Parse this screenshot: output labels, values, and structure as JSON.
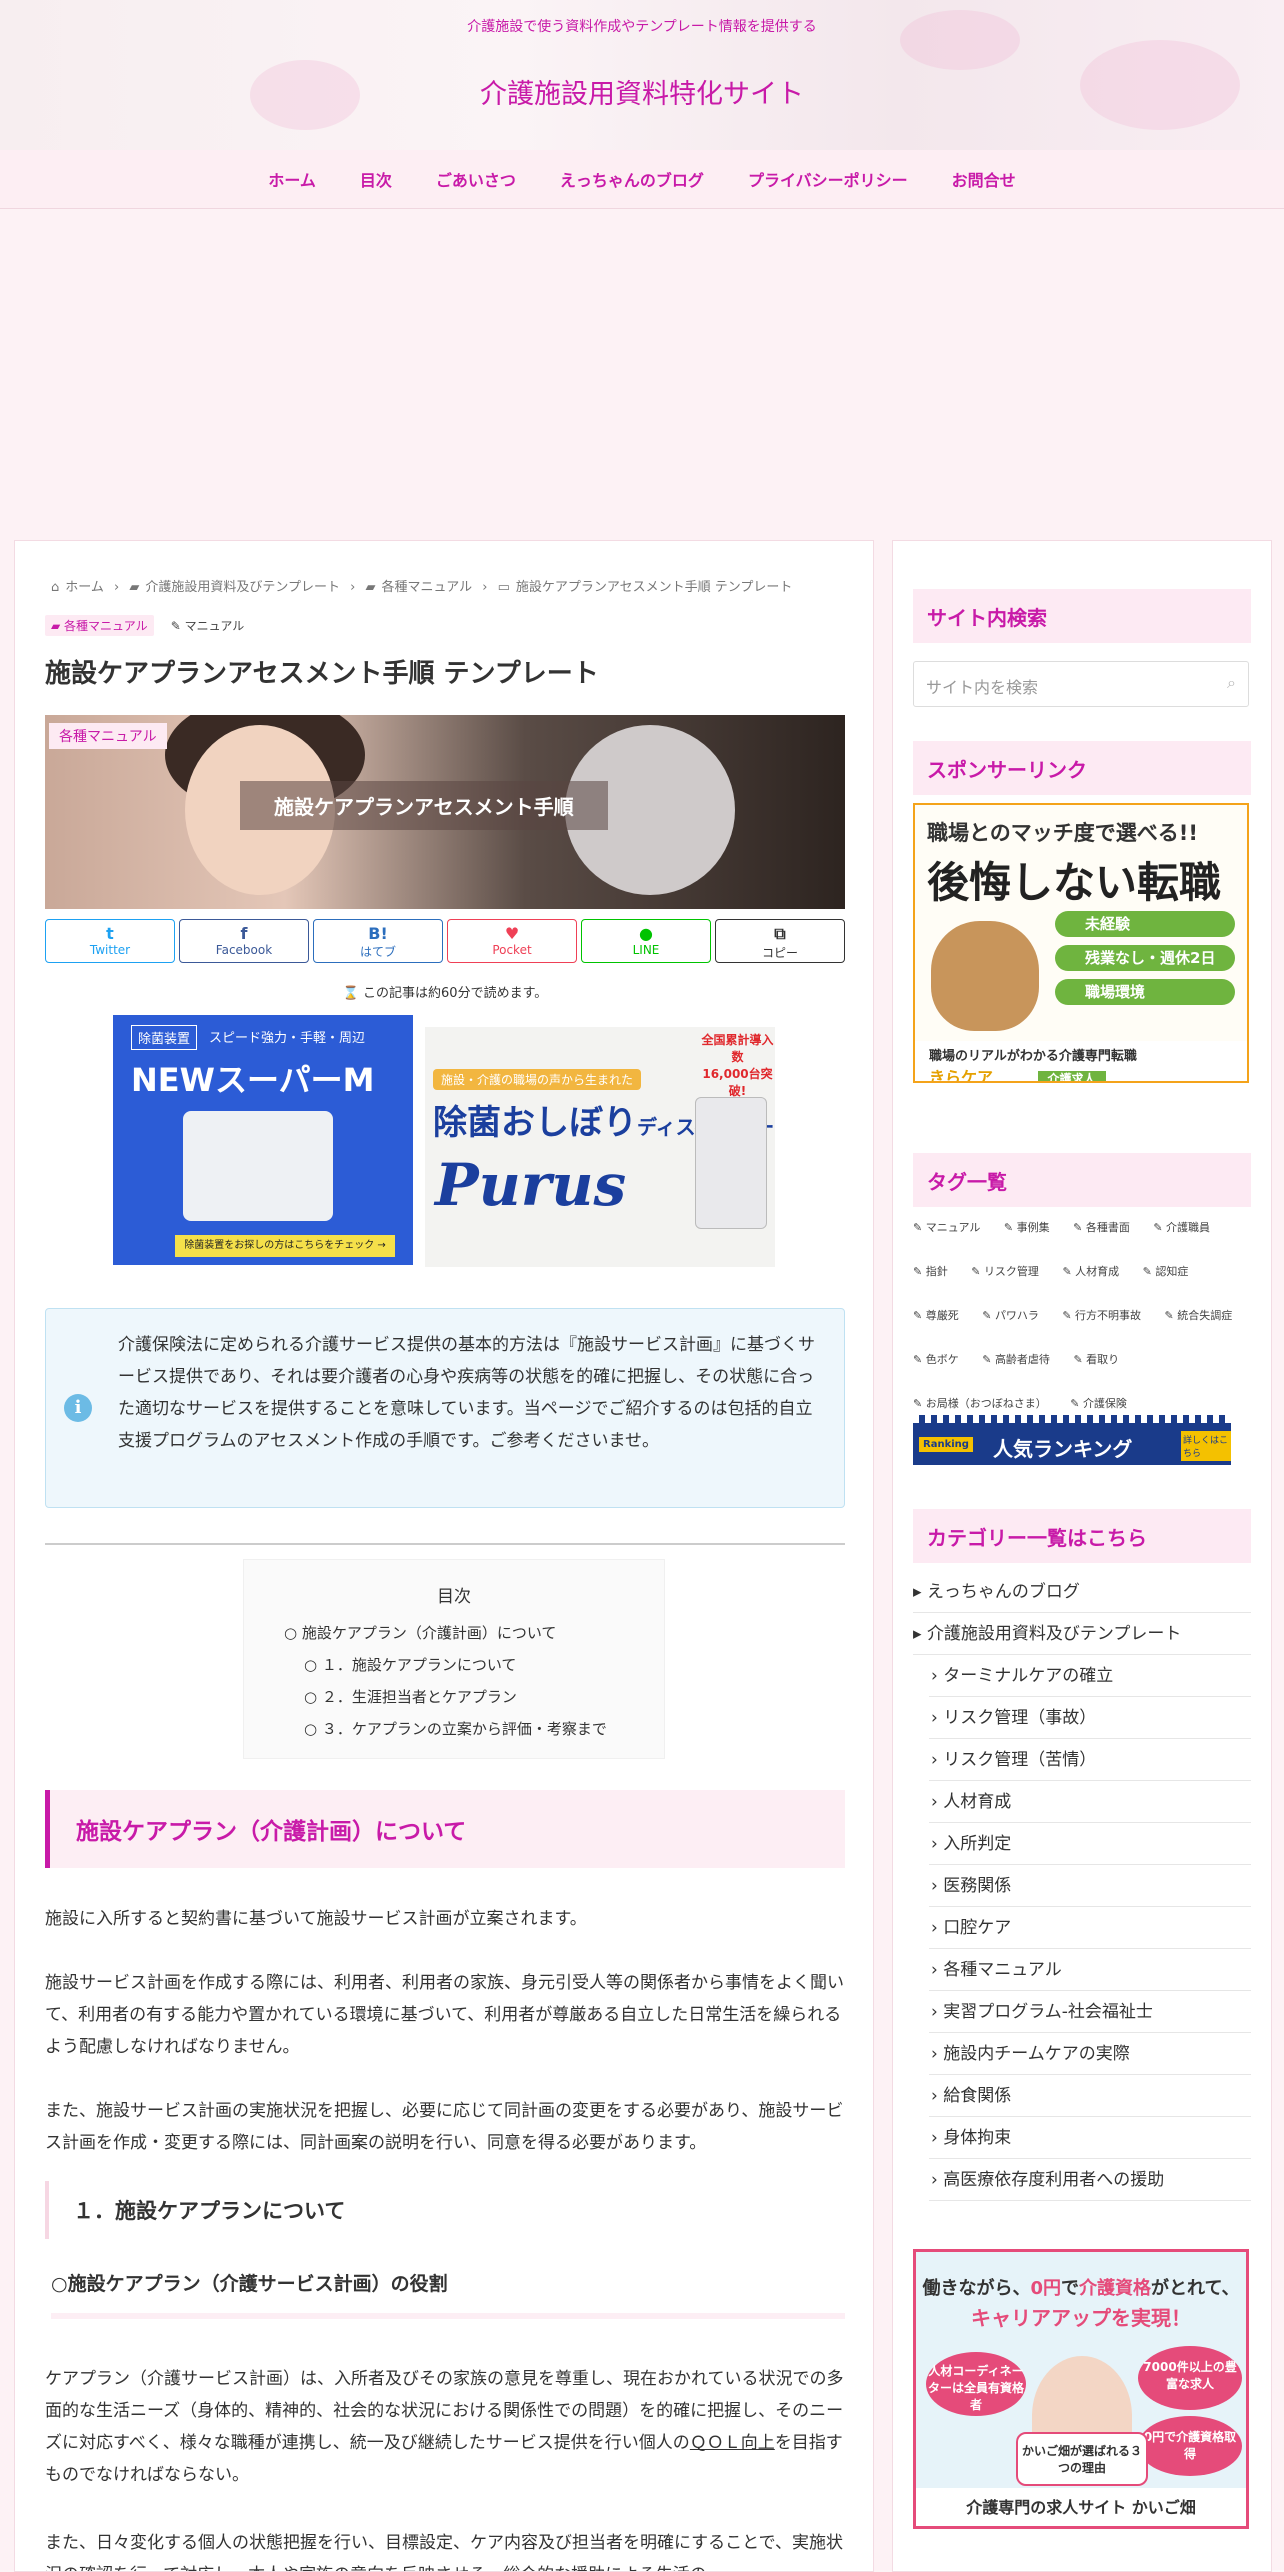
{
  "header": {
    "tagline": "介護施設で使う資料作成やテンプレート情報を提供する",
    "site_title": "介護施設用資料特化サイト"
  },
  "nav": [
    "ホーム",
    "目次",
    "ごあいさつ",
    "えっちゃんのブログ",
    "プライバシーポリシー",
    "お問合せ"
  ],
  "breadcrumb": [
    "ホーム",
    "介護施設用資料及びテンプレート",
    "各種マニュアル",
    "施設ケアプランアセスメント手順 テンプレート"
  ],
  "chips": {
    "category": "各種マニュアル",
    "tag": "マニュアル"
  },
  "article": {
    "title": "施設ケアプランアセスメント手順 テンプレート",
    "eyecatch_label": "各種マニュアル",
    "eyecatch_title": "施設ケアプランアセスメント手順",
    "shares": [
      {
        "icon": "twitter-icon",
        "glyph": "t",
        "label": "Twitter",
        "color": "#1da1f2"
      },
      {
        "icon": "facebook-icon",
        "glyph": "f",
        "label": "Facebook",
        "color": "#3b5998"
      },
      {
        "icon": "hatena-icon",
        "glyph": "B!",
        "label": "はてブ",
        "color": "#2c6ebd"
      },
      {
        "icon": "pocket-icon",
        "glyph": "♥",
        "label": "Pocket",
        "color": "#ef4056"
      },
      {
        "icon": "line-icon",
        "glyph": "●",
        "label": "LINE",
        "color": "#00c300"
      },
      {
        "icon": "copy-icon",
        "glyph": "⧉",
        "label": "コピー",
        "color": "#333"
      }
    ],
    "read_time": "⌛ この記事は約60分で読めます。",
    "ad1": {
      "tag": "除菌装置",
      "sub": "スピード強力・手軽・周辺",
      "big": "NEWスーパーM",
      "bar": "除菌装置をお探しの方はこちらをチェック →"
    },
    "ad2": {
      "t1": "施設・介護の職場の声から生まれた",
      "t2": "除菌おしぼり",
      "t2b": "ディスペンサー",
      "t3": "Purus",
      "t4": "全国累計導入数",
      "t4b": "16,000台突破!"
    },
    "info": "介護保険法に定められる介護サービス提供の基本的方法は『施設サービス計画』に基づくサービス提供であり、それは要介護者の心身や疾病等の状態を的確に把握し、その状態に合った適切なサービスを提供することを意味しています。当ページでご紹介するのは包括的自立支援プログラムのアセスメント作成の手順です。ご参考くださいませ。",
    "toc_title": "目次",
    "toc": [
      "施設ケアプラン（介護計画）について",
      "１．施設ケアプランについて",
      "２．生涯担当者とケアプラン",
      "３．ケアプランの立案から評価・考察まで"
    ],
    "h2": "施設ケアプラン（介護計画）について",
    "p1": "施設に入所すると契約書に基づいて施設サービス計画が立案されます。",
    "p2": "施設サービス計画を作成する際には、利用者、利用者の家族、身元引受人等の関係者から事情をよく聞いて、利用者の有する能力や置かれている環境に基づいて、利用者が尊厳ある自立した日常生活を繰られるよう配慮しなければなりません。",
    "p3": "また、施設サービス計画の実施状況を把握し、必要に応じて同計画の変更をする必要があり、施設サービス計画を作成・変更する際には、同計画案の説明を行い、同意を得る必要があります。",
    "h3": "１．施設ケアプランについて",
    "h4": "○施設ケアプラン（介護サービス計画）の役割",
    "p4a": "ケアプラン（介護サービス計画）は、入所者及びその家族の意見を尊重し、現在おかれている状況での多面的な生活ニーズ（身体的、精神的、社会的な状況における関係性での問題）を的確に把握し、そのニーズに対応すべく、様々な職種が連携し、統一及び継続したサービス提供を行い個人の",
    "p4u": "ＱＯＬ向上",
    "p4b": "を目指すものでなければならない。",
    "p5": "また、日々変化する個人の状態把握を行い、目標設定、ケア内容及び担当者を明確にすることで、実施状況の確認を行って対応し、本人や家族の意向を反映させる。総合的な援助による生活の"
  },
  "sidebar": {
    "search_title": "サイト内検索",
    "search_placeholder": "サイト内を検索",
    "sponsor_title": "スポンサーリンク",
    "sponsor": {
      "l1": "職場とのマッチ度で選べる!!",
      "l2": "後悔しない転職",
      "pills": [
        "未経験",
        "残業なし・週休2日",
        "職場環境"
      ],
      "foot": "職場のリアルがわかる介護専門転職",
      "brand": "きらケア",
      "btn": "介護求人"
    },
    "tags_title": "タグ一覧",
    "tags": [
      "マニュアル",
      "事例集",
      "各種書面",
      "介護職員",
      "指針",
      "リスク管理",
      "人材育成",
      "認知症",
      "尊厳死",
      "パワハラ",
      "行方不明事故",
      "統合失調症",
      "色ボケ",
      "高齢者虐待",
      "看取り",
      "お局様（おつぼねさま）",
      "介護保険"
    ],
    "ranking": {
      "r": "Ranking",
      "t": "人気ランキング",
      "s": "詳しくはこちら"
    },
    "cat_title": "カテゴリー一覧はこちら",
    "cats_top": [
      "えっちゃんのブログ",
      "介護施設用資料及びテンプレート"
    ],
    "cats_sub": [
      "ターミナルケアの確立",
      "リスク管理（事故）",
      "リスク管理（苦情）",
      "人材育成",
      "入所判定",
      "医務関係",
      "口腔ケア",
      "各種マニュアル",
      "実習プログラム-社会福祉士",
      "施設内チームケアの実際",
      "給食関係",
      "身体拘束",
      "高医療依存度利用者への援助"
    ],
    "jobad": {
      "a1pre": "働きながら、",
      "a1red": "0円",
      "a1mid": "で",
      "a1red2": "介護資格",
      "a1post": "がとれて、",
      "a2": "キャリアアップを実現！",
      "c1": "人材コーディネーターは全員有資格者",
      "c2": "7000件以上の豊富な求人",
      "c3": "0円で介護資格取得",
      "c4": "かいご畑が選ばれる３つの理由",
      "foot": "介護専門の求人サイト かいご畑"
    }
  },
  "colors": {
    "accent": "#c81aa8",
    "info_bg": "#eef7fc",
    "pink_bg": "#fdeef4"
  }
}
